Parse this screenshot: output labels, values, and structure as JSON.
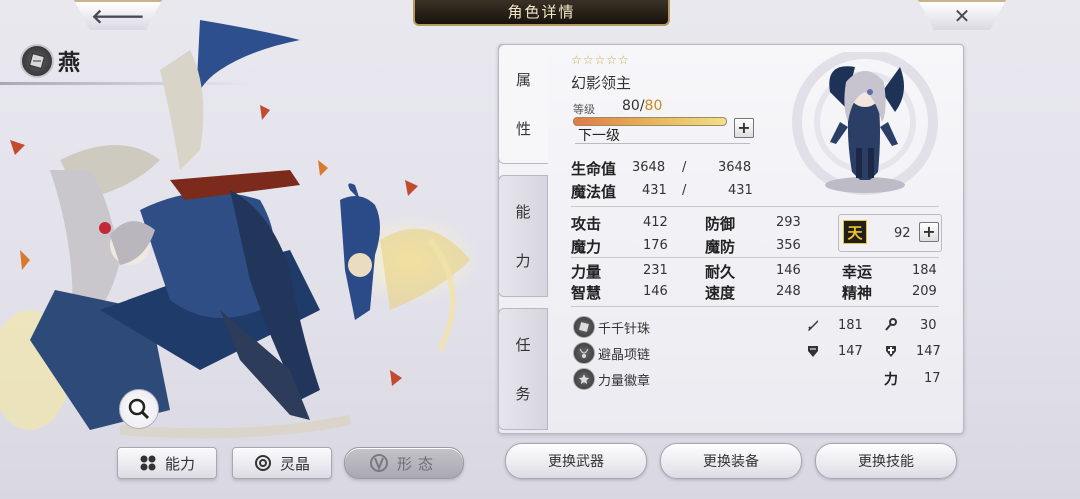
{
  "header": {
    "title": "角色详情",
    "back_icon": "arrow-left-icon",
    "close_icon": "close-icon"
  },
  "character": {
    "name": "燕"
  },
  "left_tabs": [
    {
      "label": "能力"
    },
    {
      "label": "灵晶"
    },
    {
      "label": "形态",
      "disabled": true
    }
  ],
  "side_tabs": {
    "attributes": [
      "属",
      "性"
    ],
    "abilities": [
      "能",
      "力"
    ],
    "missions": [
      "任",
      "务"
    ]
  },
  "info": {
    "stars": "☆☆☆☆☆",
    "class_name": "幻影领主",
    "level_label": "等级",
    "level_current": "80",
    "level_sep": "/",
    "level_max": "80",
    "next_level": "下一级"
  },
  "vitals": {
    "hp_label": "生命值",
    "hp": "3648",
    "hp_sep": "/",
    "hp_max": "3648",
    "mp_label": "魔法值",
    "mp": "431",
    "mp_sep": "/",
    "mp_max": "431"
  },
  "stats": {
    "atk_label": "攻击",
    "atk": "412",
    "def_label": "防御",
    "def": "293",
    "mag_label": "魔力",
    "mag": "176",
    "mdef_label": "魔防",
    "mdef": "356",
    "str_label": "力量",
    "str": "231",
    "end_label": "耐久",
    "end": "146",
    "luck_label": "幸运",
    "luck": "184",
    "wis_label": "智慧",
    "wis": "146",
    "spd_label": "速度",
    "spd": "248",
    "spi_label": "精神",
    "spi": "209",
    "heaven_glyph": "天",
    "heaven": "92"
  },
  "equipment": [
    {
      "name": "千千针珠",
      "s1_icon": "sword-icon",
      "s1": "181",
      "s2_icon": "staff-icon",
      "s2": "30"
    },
    {
      "name": "避晶项链",
      "s1_icon": "shield-icon",
      "s1": "147",
      "s2_icon": "shield-cross-icon",
      "s2": "147"
    },
    {
      "name": "力量徽章",
      "s2_label": "力",
      "s2": "17"
    }
  ],
  "bottom_buttons": {
    "weapon": "更换武器",
    "gear": "更换装备",
    "skill": "更换技能"
  },
  "colors": {
    "accent_gold": "#c9a64a",
    "exp_start": "#e07a45",
    "exp_end": "#f2e08a",
    "level_max": "#c98a1e"
  }
}
